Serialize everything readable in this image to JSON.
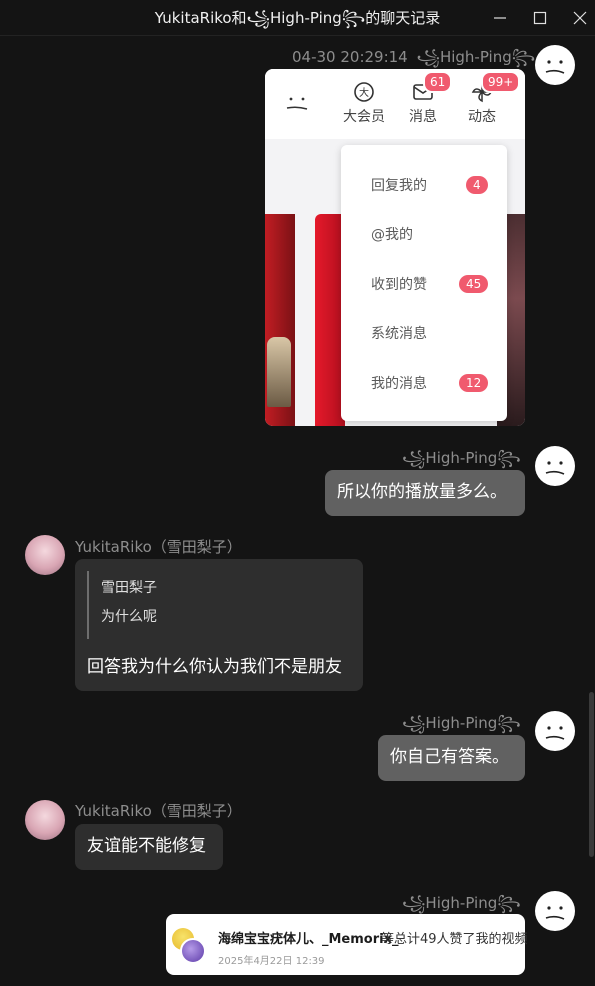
{
  "window": {
    "title": "YukitaRiko和꧁High-Ping꧂的聊天记录",
    "minimize_label": "minimize-icon",
    "maximize_label": "maximize-icon",
    "close_label": "close-icon"
  },
  "users": {
    "me": "꧁High-Ping꧂",
    "other": "YukitaRiko（雪田梨子）"
  },
  "messages": [
    {
      "from": "me",
      "time": "04-30 20:29:14",
      "type": "image"
    },
    {
      "from": "me",
      "type": "text",
      "text": "所以你的播放量多么。"
    },
    {
      "from": "other",
      "type": "quote_reply",
      "quote_name": "雪田梨子",
      "quote_text": "为什么呢",
      "text": "回答我为什么你认为我们不是朋友"
    },
    {
      "from": "me",
      "type": "text",
      "text": "你自己有答案。"
    },
    {
      "from": "other",
      "type": "text",
      "text": "友谊能不能修复"
    },
    {
      "from": "me",
      "type": "share_card",
      "card_name": "海绵宝宝疣体儿、_Memorix_",
      "card_desc": "等总计49人赞了我的视频",
      "card_time": "2025年4月22日 12:39"
    }
  ],
  "screenshot": {
    "nav": [
      {
        "label": "大会员",
        "icon": "vip-icon"
      },
      {
        "label": "消息",
        "icon": "mail-icon",
        "badge": "61"
      },
      {
        "label": "动态",
        "icon": "pinwheel-icon",
        "badge": "99+"
      }
    ],
    "menu": [
      {
        "label": "回复我的",
        "badge": "4"
      },
      {
        "label": "@我的"
      },
      {
        "label": "收到的赞",
        "badge": "45"
      },
      {
        "label": "系统消息"
      },
      {
        "label": "我的消息",
        "badge": "12"
      }
    ]
  },
  "colors": {
    "background": "#141414",
    "my_bubble": "#616161",
    "other_bubble": "#2e2e2e",
    "badge": "#f05a6e"
  }
}
